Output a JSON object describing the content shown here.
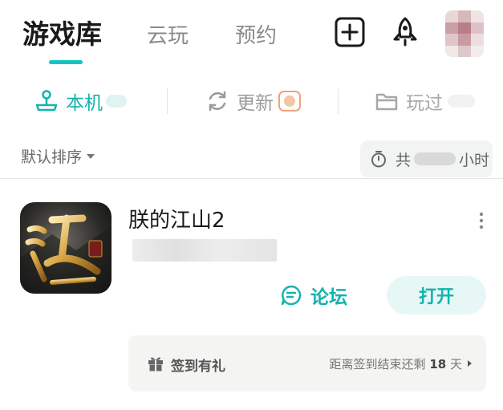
{
  "header": {
    "tabs": [
      "游戏库",
      "云玩",
      "预约"
    ]
  },
  "subtabs": {
    "local": "本机",
    "update": "更新",
    "played": "玩过"
  },
  "sort": {
    "label": "默认排序",
    "playtime_prefix": "共",
    "playtime_suffix": "小时"
  },
  "game": {
    "title": "朕的江山2",
    "forum_label": "论坛",
    "open_label": "打开"
  },
  "checkin": {
    "label": "签到有礼",
    "remain_prefix": "距离签到结束还剩",
    "days": "18",
    "unit": "天"
  },
  "colors": {
    "accent": "#14c4bf",
    "accent_text": "#14b3ae"
  }
}
